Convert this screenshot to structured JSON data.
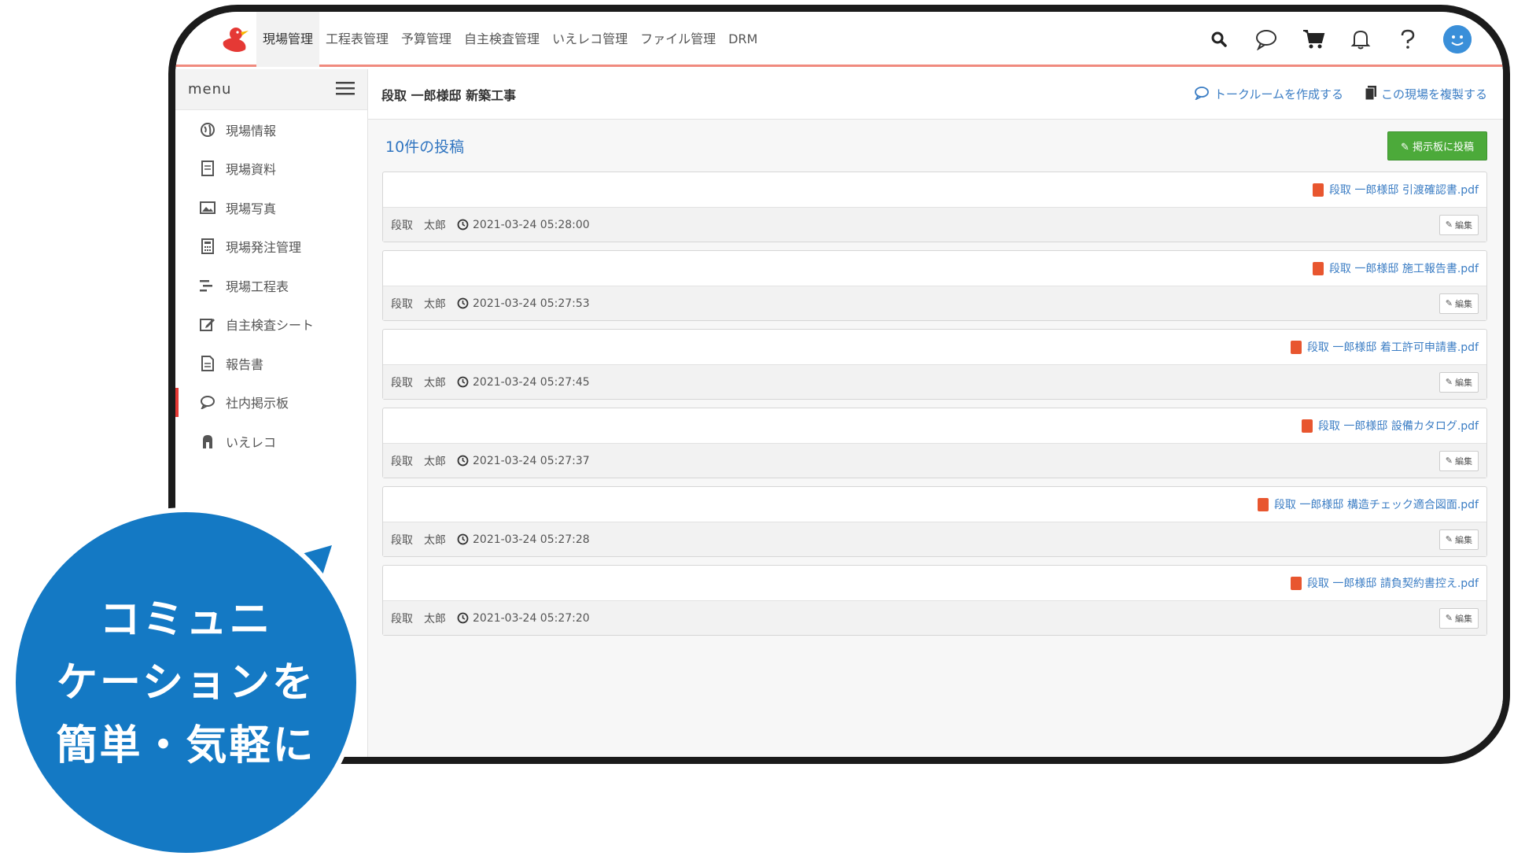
{
  "nav": {
    "items": [
      "現場管理",
      "工程表管理",
      "予算管理",
      "自主検査管理",
      "いえレコ管理",
      "ファイル管理",
      "DRM"
    ],
    "active": 0,
    "icons": [
      "search-icon",
      "chat-icon",
      "cart-icon",
      "bell-icon",
      "help-icon",
      "avatar"
    ]
  },
  "sidebar": {
    "title": "menu",
    "items": [
      {
        "label": "現場情報",
        "icon": "globe-icon"
      },
      {
        "label": "現場資料",
        "icon": "document-icon"
      },
      {
        "label": "現場写真",
        "icon": "image-icon"
      },
      {
        "label": "現場発注管理",
        "icon": "calculator-icon"
      },
      {
        "label": "現場工程表",
        "icon": "gantt-icon"
      },
      {
        "label": "自主検査シート",
        "icon": "edit-icon"
      },
      {
        "label": "報告書",
        "icon": "report-icon"
      },
      {
        "label": "社内掲示板",
        "icon": "chat-icon",
        "active": true
      },
      {
        "label": "いえレコ",
        "icon": "house-icon"
      }
    ]
  },
  "main": {
    "title": "段取 一郎様邸 新築工事",
    "actions": {
      "talk_room": "トークルームを作成する",
      "copy_site": "この現場を複製する"
    },
    "post_count": "10件の投稿",
    "post_button": "掲示板に投稿",
    "posts": [
      {
        "file": "段取 一郎様邸 引渡確認書.pdf",
        "author": "段取　太郎",
        "time": "2021-03-24 05:28:00",
        "edit": "編集"
      },
      {
        "file": "段取 一郎様邸 施工報告書.pdf",
        "author": "段取　太郎",
        "time": "2021-03-24 05:27:53",
        "edit": "編集"
      },
      {
        "file": "段取 一郎様邸 着工許可申請書.pdf",
        "author": "段取　太郎",
        "time": "2021-03-24 05:27:45",
        "edit": "編集"
      },
      {
        "file": "段取 一郎様邸 設備カタログ.pdf",
        "author": "段取　太郎",
        "time": "2021-03-24 05:27:37",
        "edit": "編集"
      },
      {
        "file": "段取 一郎様邸 構造チェック適合図面.pdf",
        "author": "段取　太郎",
        "time": "2021-03-24 05:27:28",
        "edit": "編集"
      },
      {
        "file": "段取 一郎様邸 請負契約書控え.pdf",
        "author": "段取　太郎",
        "time": "2021-03-24 05:27:20",
        "edit": "編集"
      }
    ]
  },
  "bubble": {
    "lines": [
      "コミュニ",
      "ケーションを",
      "簡単・気軽に"
    ],
    "color": "#1479c4"
  },
  "colors": {
    "accent_red": "#e53935",
    "nav_underline": "#f08a7e",
    "link_blue": "#3b7dc4",
    "post_button_green": "#4caa3a"
  }
}
